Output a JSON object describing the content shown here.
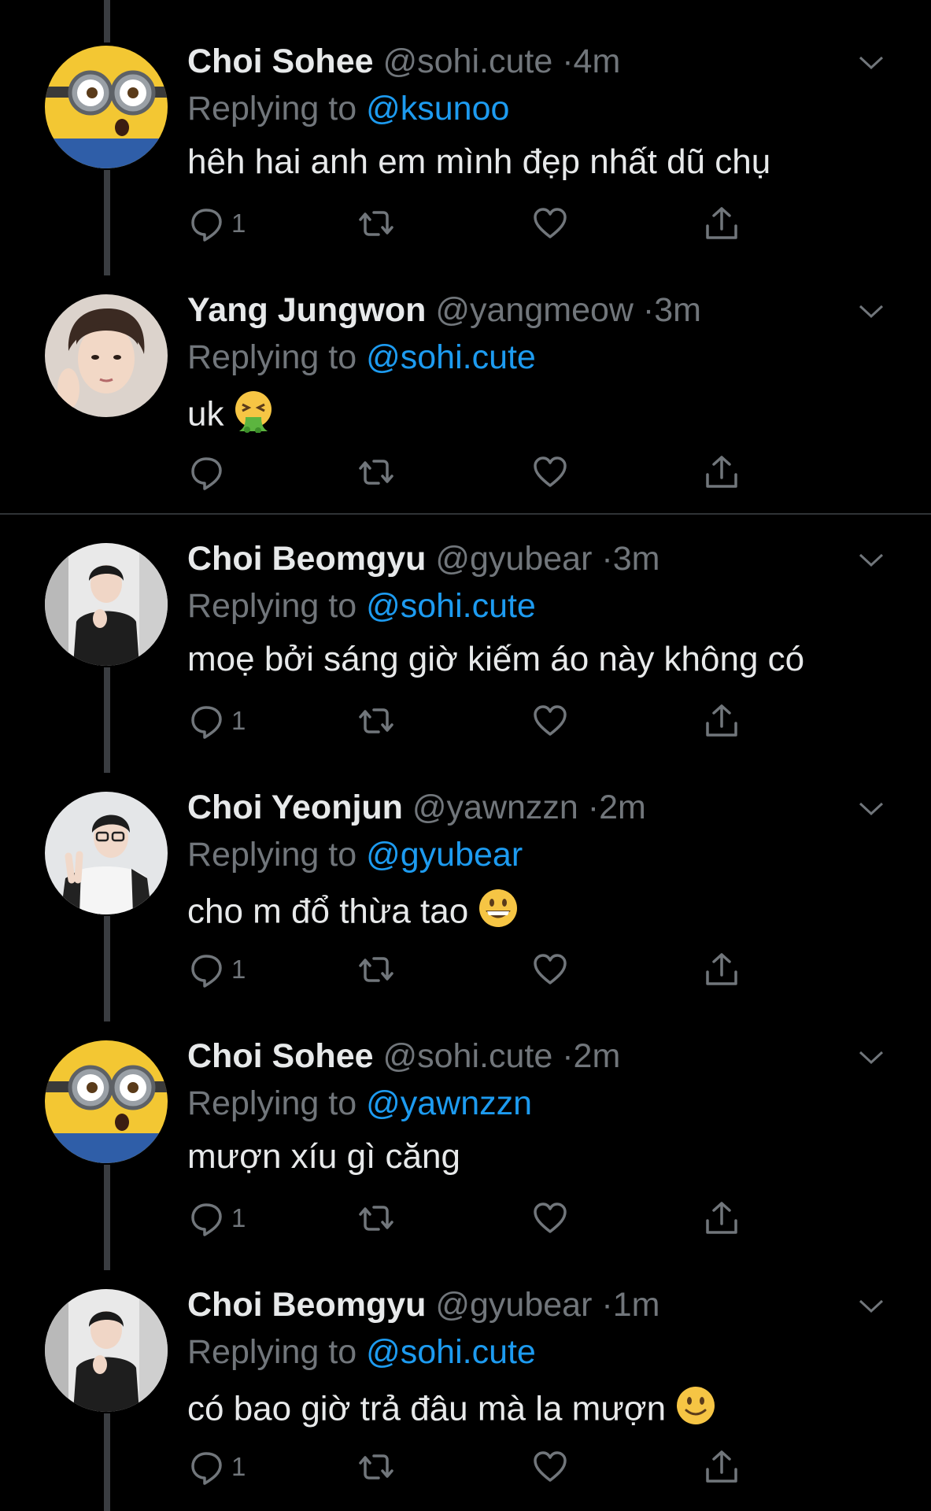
{
  "tweets": [
    {
      "name": "Choi Sohee",
      "handle": "@sohi.cute",
      "time": "4m",
      "replying_prefix": "Replying to",
      "replying_to": "@ksunoo",
      "text": "hêh hai anh em mình đẹp nhất dũ chụ",
      "reply_count": "1",
      "avatar": "minion-avatar"
    },
    {
      "name": "Yang Jungwon",
      "handle": "@yangmeow",
      "time": "3m",
      "replying_prefix": "Replying to",
      "replying_to": "@sohi.cute",
      "text": "uk",
      "reply_count": "",
      "avatar": "person-avatar",
      "emoji": "vomiting-face-emoji"
    },
    {
      "name": "Choi Beomgyu",
      "handle": "@gyubear",
      "time": "3m",
      "replying_prefix": "Replying to",
      "replying_to": "@sohi.cute",
      "text": "moẹ bởi sáng giờ kiếm áo này không có",
      "reply_count": "1",
      "avatar": "person-avatar"
    },
    {
      "name": "Choi Yeonjun",
      "handle": "@yawnzzn",
      "time": "2m",
      "replying_prefix": "Replying to",
      "replying_to": "@gyubear",
      "text": "cho m đổ thừa tao",
      "reply_count": "1",
      "avatar": "person-avatar",
      "emoji": "grinning-face-emoji"
    },
    {
      "name": "Choi Sohee",
      "handle": "@sohi.cute",
      "time": "2m",
      "replying_prefix": "Replying to",
      "replying_to": "@yawnzzn",
      "text": "mượn xíu gì căng",
      "reply_count": "1",
      "avatar": "minion-avatar"
    },
    {
      "name": "Choi Beomgyu",
      "handle": "@gyubear",
      "time": "1m",
      "replying_prefix": "Replying to",
      "replying_to": "@sohi.cute",
      "text": "có bao giờ trả đâu mà la mượn",
      "reply_count": "1",
      "avatar": "person-avatar",
      "emoji": "slightly-smiling-face-emoji"
    }
  ],
  "separator": "·",
  "colors": {
    "background": "#000000",
    "text": "#e7e9ea",
    "secondary": "#71767b",
    "mention": "#1d9bf0",
    "thread_line": "#3a3d41",
    "divider": "#2f3336"
  }
}
